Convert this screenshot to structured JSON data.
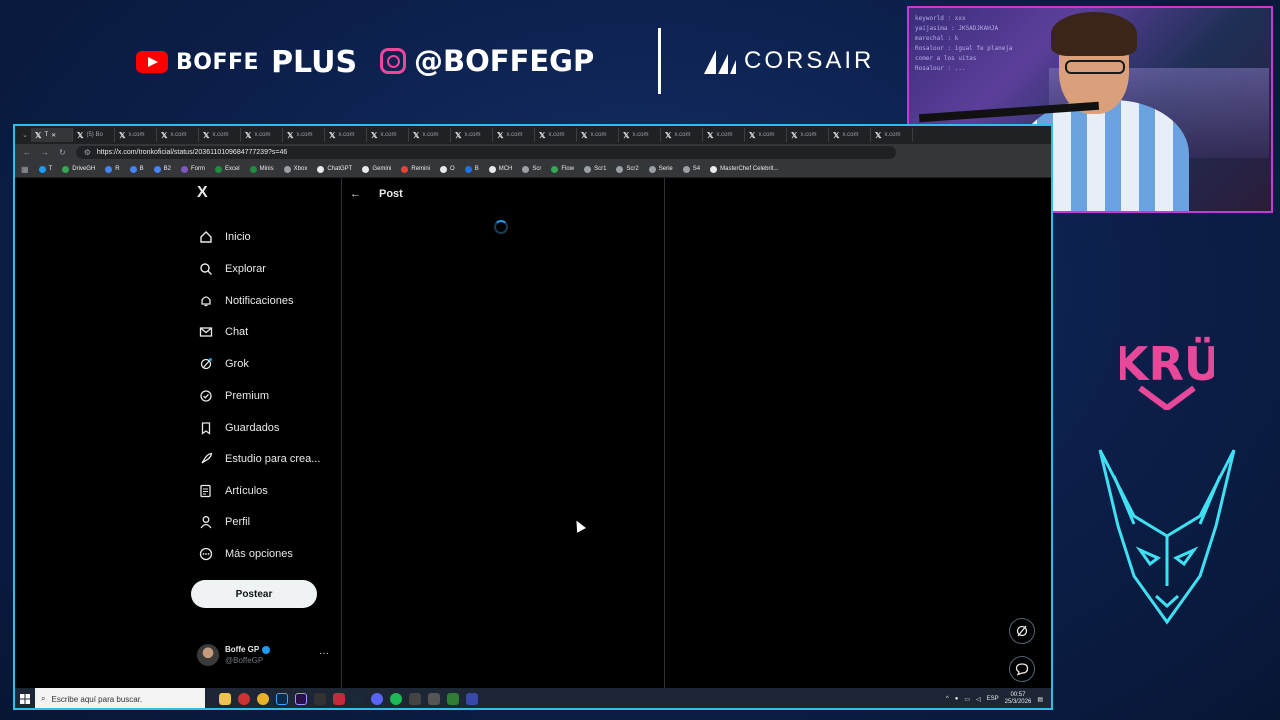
{
  "overlay": {
    "youtube_name": "BOFFE",
    "youtube_suffix": "PLUS",
    "instagram_handle": "@BOFFEGP",
    "sponsor": "CORSAIR",
    "team_logo_text": "KRÜ",
    "colors": {
      "background": "#0c1f4a",
      "webcam_border": "#c33ad6",
      "screen_border": "#2bc0e4",
      "kru_pink": "#e8489a",
      "wolf_cyan": "#3fe0f2"
    },
    "webcam_chat_lines": [
      "keyworld : xxx",
      "yaijasima : JKSADJKAHJA",
      "marechal : k",
      "Rosalour : igual fe planeja",
      "comer a los uitas",
      "Rosalour : ..."
    ]
  },
  "browser": {
    "tabs": [
      {
        "label": "T",
        "active": true
      },
      {
        "label": "(5) Bo",
        "active": false
      },
      {
        "label": "x.com",
        "active": false
      },
      {
        "label": "x.com",
        "active": false
      },
      {
        "label": "x.com",
        "active": false
      },
      {
        "label": "x.com",
        "active": false
      },
      {
        "label": "x.com",
        "active": false
      },
      {
        "label": "x.com",
        "active": false
      },
      {
        "label": "x.com",
        "active": false
      },
      {
        "label": "x.com",
        "active": false
      },
      {
        "label": "x.com",
        "active": false
      },
      {
        "label": "x.com",
        "active": false
      },
      {
        "label": "x.com",
        "active": false
      },
      {
        "label": "x.com",
        "active": false
      },
      {
        "label": "x.com",
        "active": false
      },
      {
        "label": "x.com",
        "active": false
      },
      {
        "label": "x.com",
        "active": false
      },
      {
        "label": "x.com",
        "active": false
      },
      {
        "label": "x.com",
        "active": false
      },
      {
        "label": "x.com",
        "active": false
      },
      {
        "label": "x.com",
        "active": false
      }
    ],
    "url": "https://x.com/tronkoficial/status/2036110109684777239?s=46",
    "bookmarks": [
      {
        "label": "T",
        "color": "#1d9bf0"
      },
      {
        "label": "DriveGH",
        "color": "#34a853"
      },
      {
        "label": "R",
        "color": "#4285f4"
      },
      {
        "label": "B",
        "color": "#4285f4"
      },
      {
        "label": "B2",
        "color": "#4285f4"
      },
      {
        "label": "Form",
        "color": "#7e57c2"
      },
      {
        "label": "Excel",
        "color": "#1e8e3e"
      },
      {
        "label": "Minis",
        "color": "#1e8e3e"
      },
      {
        "label": "Xbox",
        "color": "#9aa0a6"
      },
      {
        "label": "ChatGPT",
        "color": "#e8eaed"
      },
      {
        "label": "Gemini",
        "color": "#e8eaed"
      },
      {
        "label": "Remini",
        "color": "#ea4335"
      },
      {
        "label": "O",
        "color": "#e8eaed"
      },
      {
        "label": "B",
        "color": "#1a73e8"
      },
      {
        "label": "MCH",
        "color": "#e8eaed"
      },
      {
        "label": "Scr",
        "color": "#9aa0a6"
      },
      {
        "label": "Flow",
        "color": "#34a853"
      },
      {
        "label": "Scr1",
        "color": "#9aa0a6"
      },
      {
        "label": "Scr2",
        "color": "#9aa0a6"
      },
      {
        "label": "Serie",
        "color": "#9aa0a6"
      },
      {
        "label": "S4",
        "color": "#9aa0a6"
      },
      {
        "label": "MasterChef Celebrit...",
        "color": "#e8eaed"
      }
    ]
  },
  "x": {
    "logo": "X",
    "nav": [
      {
        "label": "Inicio",
        "icon": "home-icon"
      },
      {
        "label": "Explorar",
        "icon": "search-icon"
      },
      {
        "label": "Notificaciones",
        "icon": "bell-icon"
      },
      {
        "label": "Chat",
        "icon": "mail-icon"
      },
      {
        "label": "Grok",
        "icon": "grok-icon"
      },
      {
        "label": "Premium",
        "icon": "verified-icon"
      },
      {
        "label": "Guardados",
        "icon": "bookmark-icon"
      },
      {
        "label": "Estudio para crea...",
        "icon": "rocket-icon"
      },
      {
        "label": "Artículos",
        "icon": "article-icon"
      },
      {
        "label": "Perfil",
        "icon": "person-icon"
      },
      {
        "label": "Más opciones",
        "icon": "more-circle-icon"
      }
    ],
    "post_button": "Postear",
    "account": {
      "name": "Boffe GP",
      "handle": "@BoffeGP"
    },
    "main": {
      "back": "←",
      "title": "Post"
    }
  },
  "taskbar": {
    "search_placeholder": "Escribe aquí para buscar.",
    "language": "ESP",
    "time": "00:57",
    "date": "25/3/2026"
  }
}
